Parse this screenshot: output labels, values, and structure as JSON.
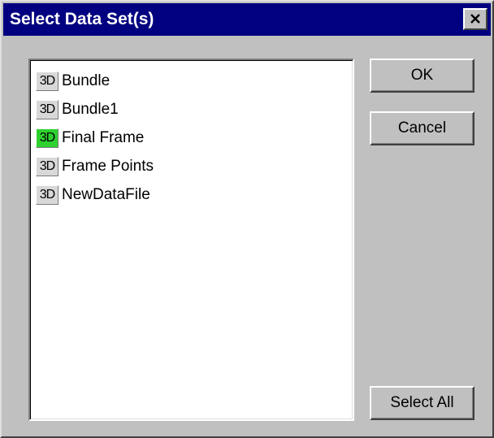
{
  "window": {
    "title": "Select Data Set(s)",
    "close_icon": "close-icon"
  },
  "list": {
    "items": [
      {
        "badge": "3D",
        "label": "Bundle",
        "active": false
      },
      {
        "badge": "3D",
        "label": "Bundle1",
        "active": false
      },
      {
        "badge": "3D",
        "label": "Final Frame",
        "active": true
      },
      {
        "badge": "3D",
        "label": "Frame Points",
        "active": false
      },
      {
        "badge": "3D",
        "label": "NewDataFile",
        "active": false
      }
    ]
  },
  "buttons": {
    "ok_label": "OK",
    "cancel_label": "Cancel",
    "select_all_label": "Select All"
  },
  "colors": {
    "titlebar": "#000080",
    "face": "#c0c0c0",
    "active_badge": "#2ed12e"
  }
}
